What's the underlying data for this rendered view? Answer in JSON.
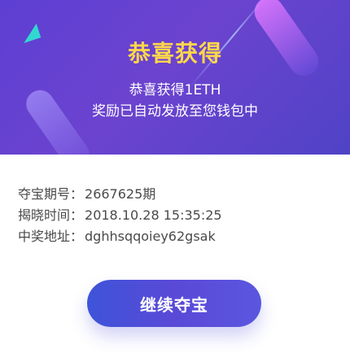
{
  "header": {
    "title": "恭喜获得",
    "subtitle_line1": "恭喜获得1ETH",
    "subtitle_line2": "奖励已自动发放至您钱包中",
    "background_colors": [
      "#5d3fd3",
      "#4f43c6"
    ],
    "title_color": "#ffd64c"
  },
  "details": {
    "rows": [
      {
        "label": "夺宝期号：",
        "value": "2667625期"
      },
      {
        "label": "揭晓时间：",
        "value": "2018.10.28 15:35:25"
      },
      {
        "label": "中奖地址：",
        "value": "dghhsqqoiey62gsak"
      }
    ]
  },
  "actions": {
    "continue_label": "继续夺宝",
    "button_colors": [
      "#3d54d9",
      "#5a56df"
    ]
  },
  "decorations": {
    "icons": [
      "triangle-shape",
      "capsule-shape",
      "diagonal-line-shape"
    ]
  }
}
